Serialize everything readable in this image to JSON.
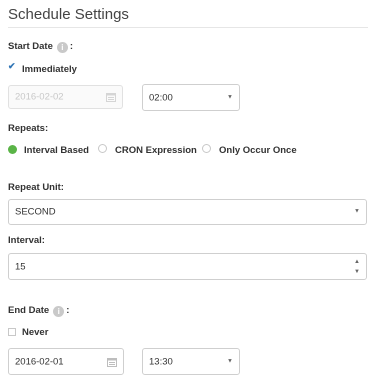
{
  "title": "Schedule Settings",
  "start_date": {
    "label": "Start Date",
    "info_icon": "info-icon",
    "colon": ":",
    "immediately_label": "Immediately",
    "immediately_checked": true,
    "date_value": "2016-02-02",
    "time_value": "02:00"
  },
  "repeats": {
    "label": "Repeats:",
    "options": [
      {
        "label": "Interval Based",
        "selected": true
      },
      {
        "label": "CRON Expression",
        "selected": false
      },
      {
        "label": "Only Occur Once",
        "selected": false
      }
    ]
  },
  "repeat_unit": {
    "label": "Repeat Unit:",
    "value": "SECOND"
  },
  "interval": {
    "label": "Interval:",
    "value": "15"
  },
  "end_date": {
    "label": "End Date",
    "colon": ":",
    "never_label": "Never",
    "never_checked": false,
    "date_value": "2016-02-01",
    "time_value": "13:30"
  },
  "colors": {
    "accent": "#5ab447",
    "check": "#2f74b5"
  }
}
